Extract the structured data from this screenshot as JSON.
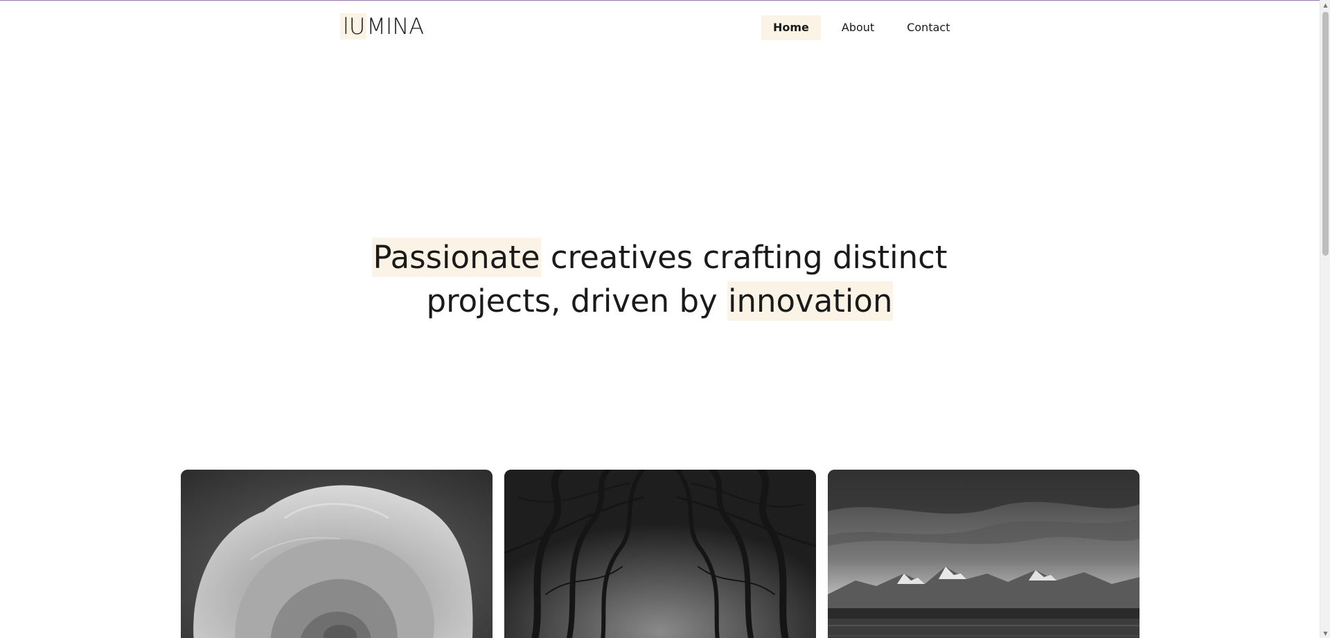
{
  "brand": {
    "logo_highlight": "lU",
    "logo_rest": "MINA"
  },
  "nav": {
    "items": [
      {
        "label": "Home",
        "active": true
      },
      {
        "label": "About",
        "active": false
      },
      {
        "label": "Contact",
        "active": false
      }
    ]
  },
  "hero": {
    "line1_highlight": "Passionate",
    "line1_rest": " creatives crafting distinct",
    "line2_start": "projects, driven by ",
    "line2_highlight": "innovation"
  },
  "gallery": {
    "images": [
      {
        "subject": "rose-image"
      },
      {
        "subject": "forest-trees-image"
      },
      {
        "subject": "mountain-lake-image"
      }
    ]
  },
  "colors": {
    "highlight": "#fbf3e6",
    "text": "#1a1a1a",
    "top_border": "#9b6fa8"
  }
}
